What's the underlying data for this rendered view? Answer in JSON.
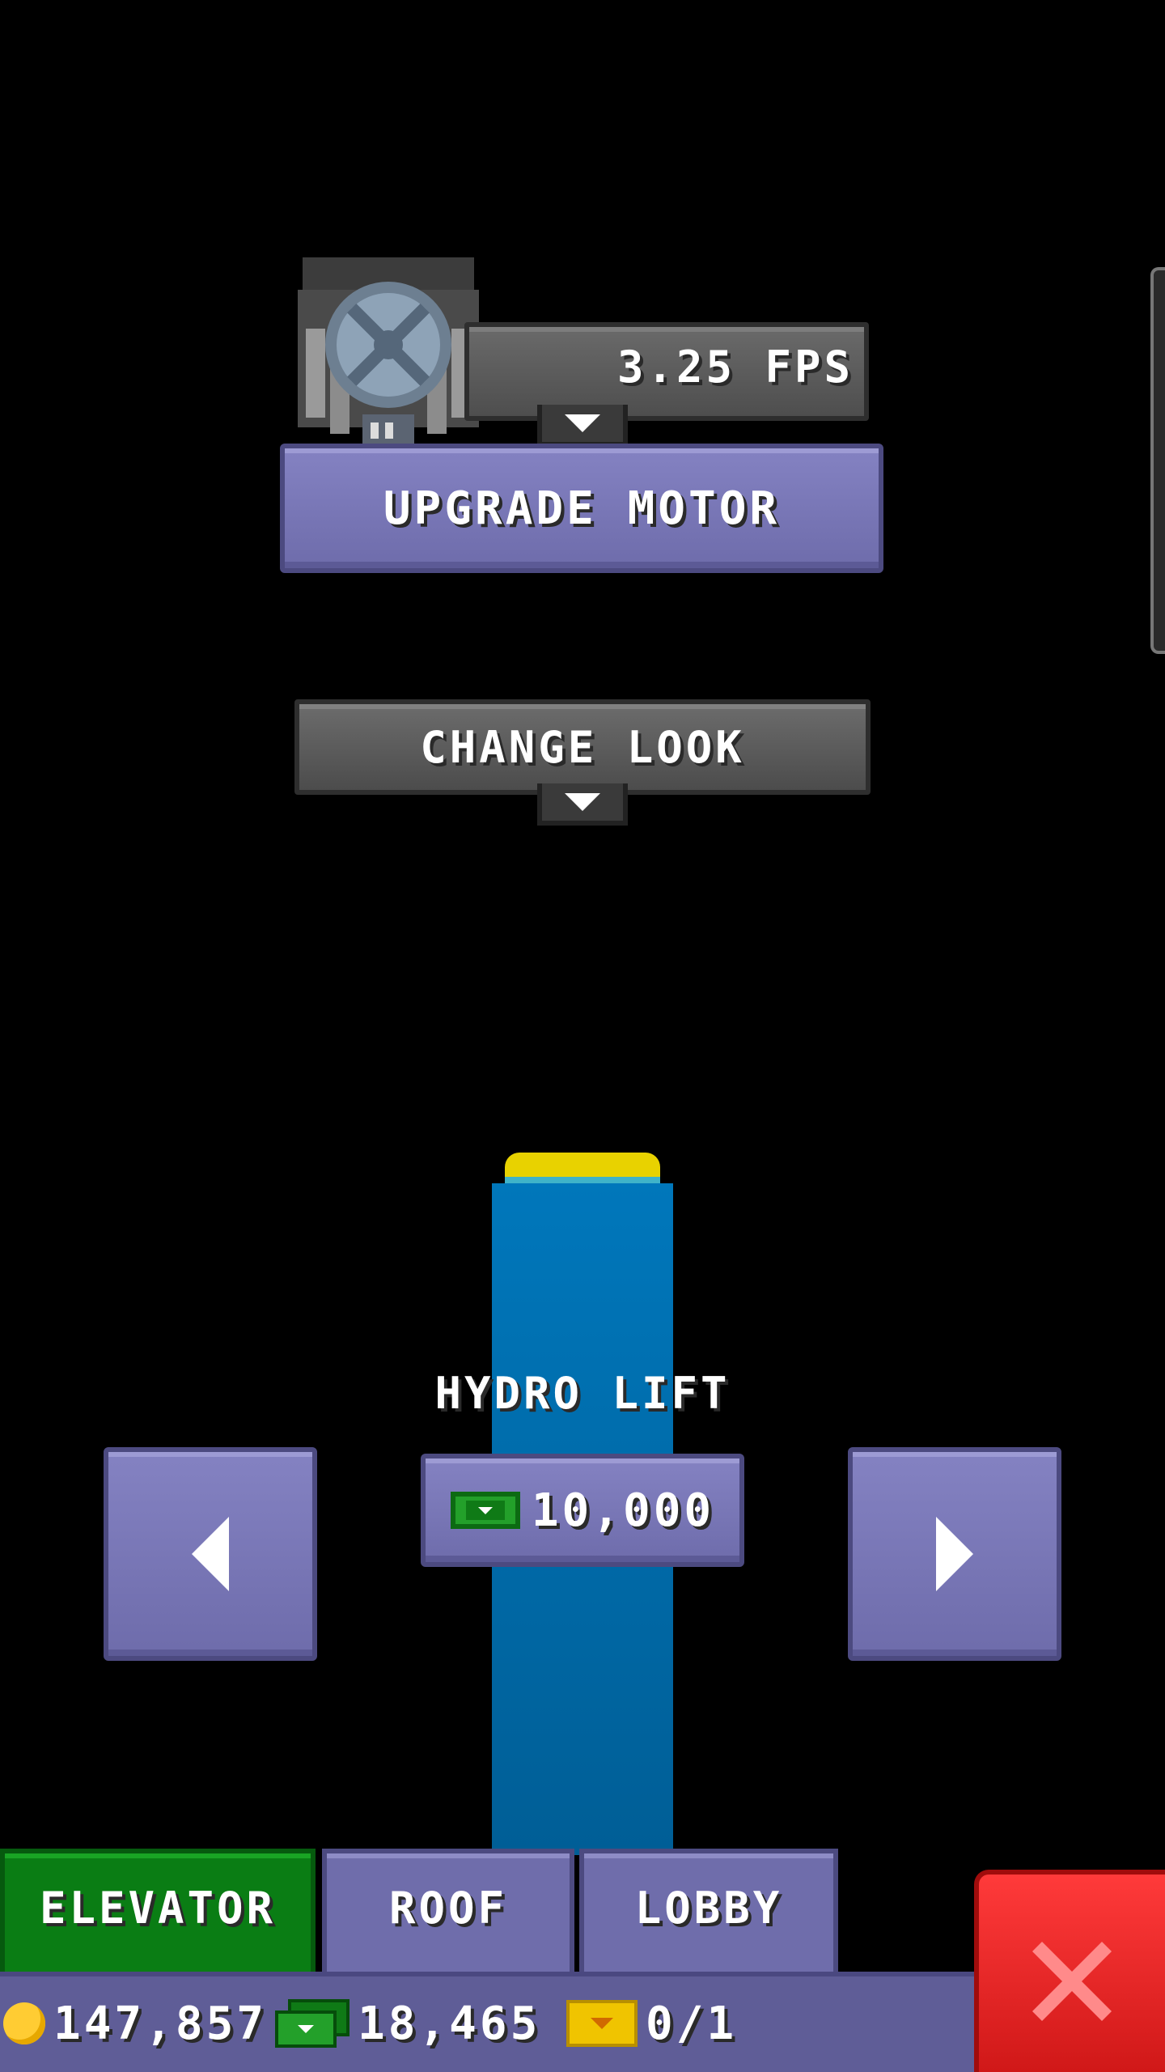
{
  "motor": {
    "speed_label": "3.25 FPS",
    "upgrade_label": "UPGRADE MOTOR"
  },
  "look": {
    "change_label": "CHANGE LOOK"
  },
  "elevator_option": {
    "name": "HYDRO LIFT",
    "price": "10,000"
  },
  "tabs": [
    {
      "label": "ELEVATOR",
      "active": true
    },
    {
      "label": "ROOF",
      "active": false
    },
    {
      "label": "LOBBY",
      "active": false
    }
  ],
  "status": {
    "coins": "147,857",
    "bux": "18,465",
    "tickets": "0/1"
  },
  "icons": {
    "motor": "motor-icon",
    "coin": "coin-icon",
    "bux": "bux-icon",
    "ticket": "ticket-icon",
    "close": "close-icon"
  },
  "colors": {
    "active_tab": "#0a7d14",
    "purple_button": "#6f6dab",
    "close_button": "#e82020",
    "shaft": "#0069a8"
  }
}
